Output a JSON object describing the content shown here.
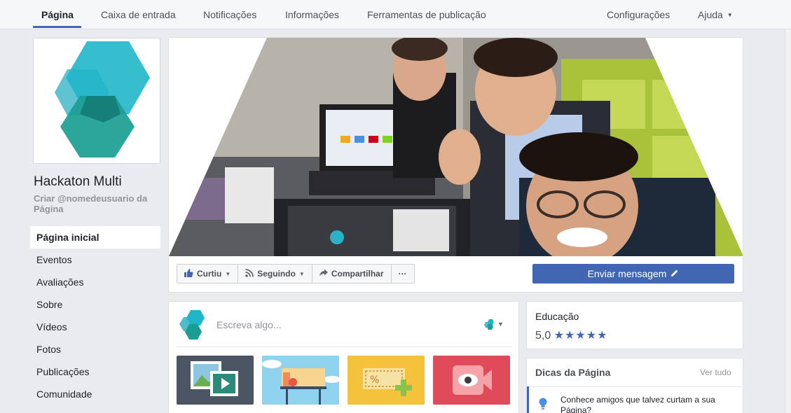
{
  "topnav": {
    "tabs": [
      {
        "label": "Página",
        "active": true
      },
      {
        "label": "Caixa de entrada"
      },
      {
        "label": "Notificações"
      },
      {
        "label": "Informações"
      },
      {
        "label": "Ferramentas de publicação"
      }
    ],
    "settings": "Configurações",
    "help": "Ajuda"
  },
  "page": {
    "name": "Hackaton Multi",
    "username_prompt": "Criar @nomedeusuario da Página"
  },
  "sidebar": {
    "items": [
      {
        "label": "Página inicial",
        "active": true
      },
      {
        "label": "Eventos"
      },
      {
        "label": "Avaliações"
      },
      {
        "label": "Sobre"
      },
      {
        "label": "Vídeos"
      },
      {
        "label": "Fotos"
      },
      {
        "label": "Publicações"
      },
      {
        "label": "Comunidade"
      }
    ]
  },
  "actions": {
    "liked": "Curtiu",
    "following": "Seguindo",
    "share": "Compartilhar",
    "more": "···",
    "send_message": "Enviar mensagem"
  },
  "composer": {
    "placeholder": "Escreva algo..."
  },
  "category_card": {
    "label": "Educação",
    "rating": "5,0",
    "stars": "★★★★★"
  },
  "tips": {
    "title": "Dicas da Página",
    "see_all": "Ver tudo",
    "tip_text": "Conhece amigos que talvez curtam a sua Página?"
  },
  "colors": {
    "brand_blue": "#4267b2",
    "logo_teal": "#2ab3c6",
    "logo_dark_teal": "#1a8f86"
  },
  "icons": [
    "like-icon",
    "rss-icon",
    "share-icon",
    "pencil-icon",
    "camera-icon",
    "bulb-icon"
  ]
}
